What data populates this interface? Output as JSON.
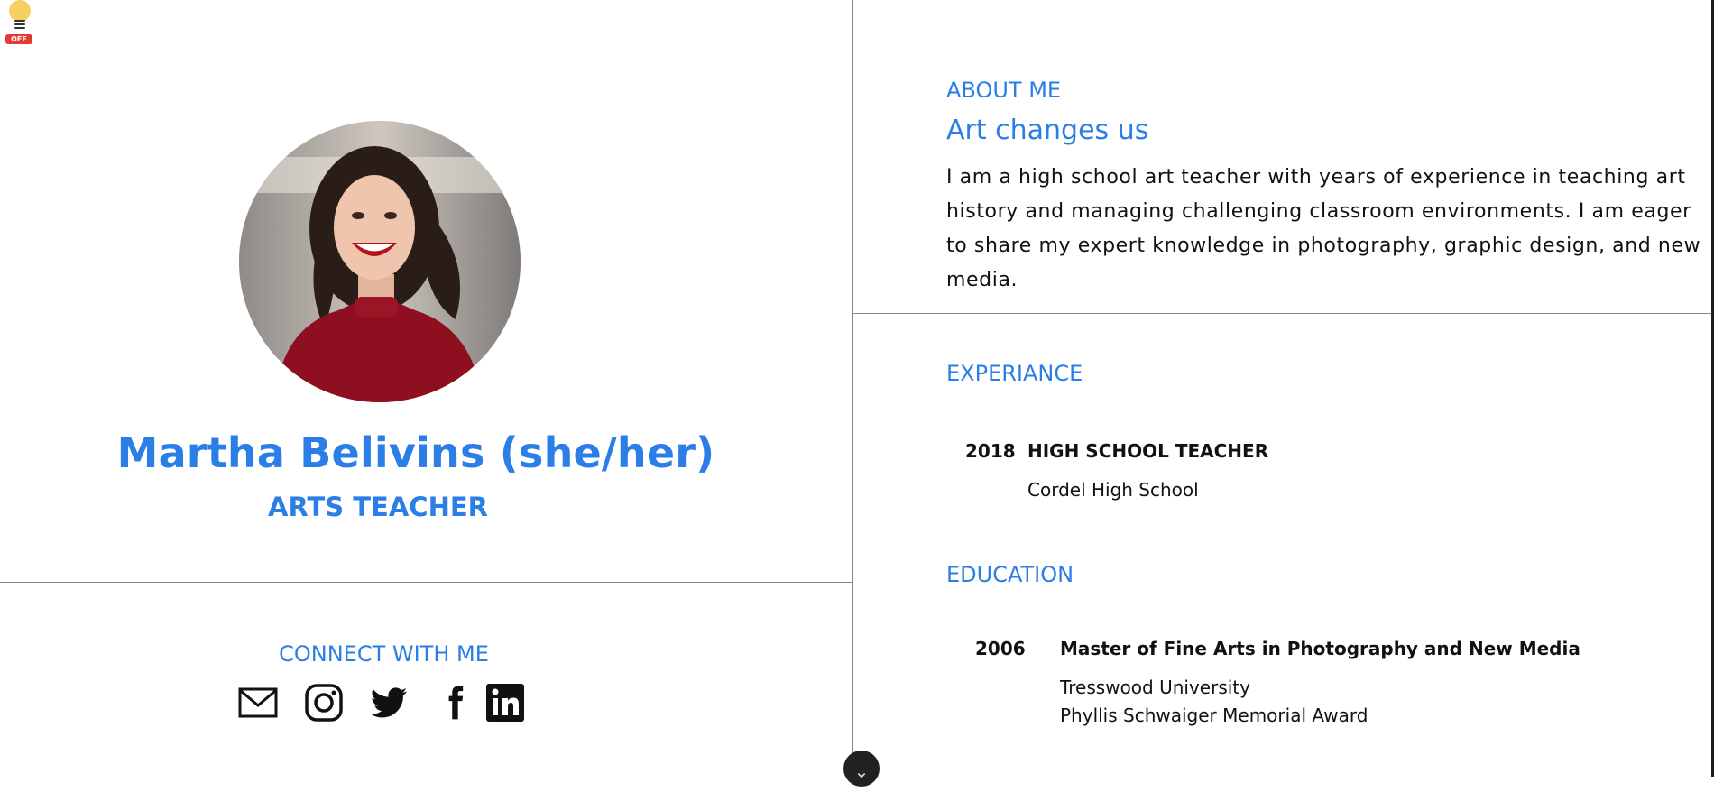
{
  "toggle": {
    "state_label": "OFF",
    "icon": "lightbulb-icon"
  },
  "profile": {
    "name": "Martha Belivins (she/her)",
    "role": "ARTS TEACHER",
    "photo": "woman-red-sweater-portrait"
  },
  "connect": {
    "heading": "CONNECT WITH ME",
    "icons": [
      "mail-icon",
      "instagram-icon",
      "twitter-icon",
      "facebook-icon",
      "linkedin-icon"
    ]
  },
  "about": {
    "label": "ABOUT ME",
    "title": "Art changes us",
    "text": "I am a high school art teacher with years of experience in teaching art history and managing challenging classroom environments. I am eager to share my expert knowledge in photography, graphic design, and new media."
  },
  "experience": {
    "label": "EXPERIANCE",
    "items": [
      {
        "year": "2018",
        "title": "HIGH SCHOOL TEACHER",
        "org": "Cordel High School"
      }
    ]
  },
  "education": {
    "label": "EDUCATION",
    "items": [
      {
        "year": "2006",
        "degree": "Master of Fine Arts in Photography and New Media",
        "school": "Tresswood University",
        "award": "Phyllis Schwaiger Memorial Award"
      }
    ]
  },
  "scroll_button": {
    "label": "⌄",
    "icon": "chevron-down-icon"
  },
  "colors": {
    "accent": "#2a7ee6",
    "divider": "#7d8799",
    "text": "#111111"
  }
}
